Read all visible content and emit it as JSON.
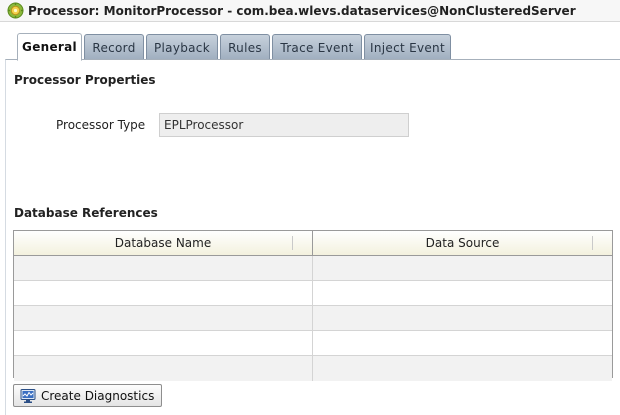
{
  "window": {
    "title": "Processor: MonitorProcessor - com.bea.wlevs.dataservices@NonClusteredServer",
    "icon": "processor-gear-icon"
  },
  "tabs": [
    {
      "label": "General",
      "active": true
    },
    {
      "label": "Record",
      "active": false
    },
    {
      "label": "Playback",
      "active": false
    },
    {
      "label": "Rules",
      "active": false
    },
    {
      "label": "Trace Event",
      "active": false
    },
    {
      "label": "Inject Event",
      "active": false
    }
  ],
  "processor_properties": {
    "heading": "Processor Properties",
    "type_label": "Processor Type",
    "type_value": "EPLProcessor"
  },
  "database_references": {
    "heading": "Database References",
    "columns": [
      "Database Name",
      "Data Source"
    ],
    "rows": [
      [
        "",
        ""
      ],
      [
        "",
        ""
      ],
      [
        "",
        ""
      ],
      [
        "",
        ""
      ],
      [
        "",
        ""
      ]
    ]
  },
  "actions": {
    "create_diagnostics_label": "Create Diagnostics",
    "create_diagnostics_icon": "diagnostics-monitor-icon"
  },
  "colors": {
    "header_gradient_bottom": "#f3f1de",
    "tab_inactive": "#a8b6c6",
    "readonly_field": "#eeeeee"
  }
}
